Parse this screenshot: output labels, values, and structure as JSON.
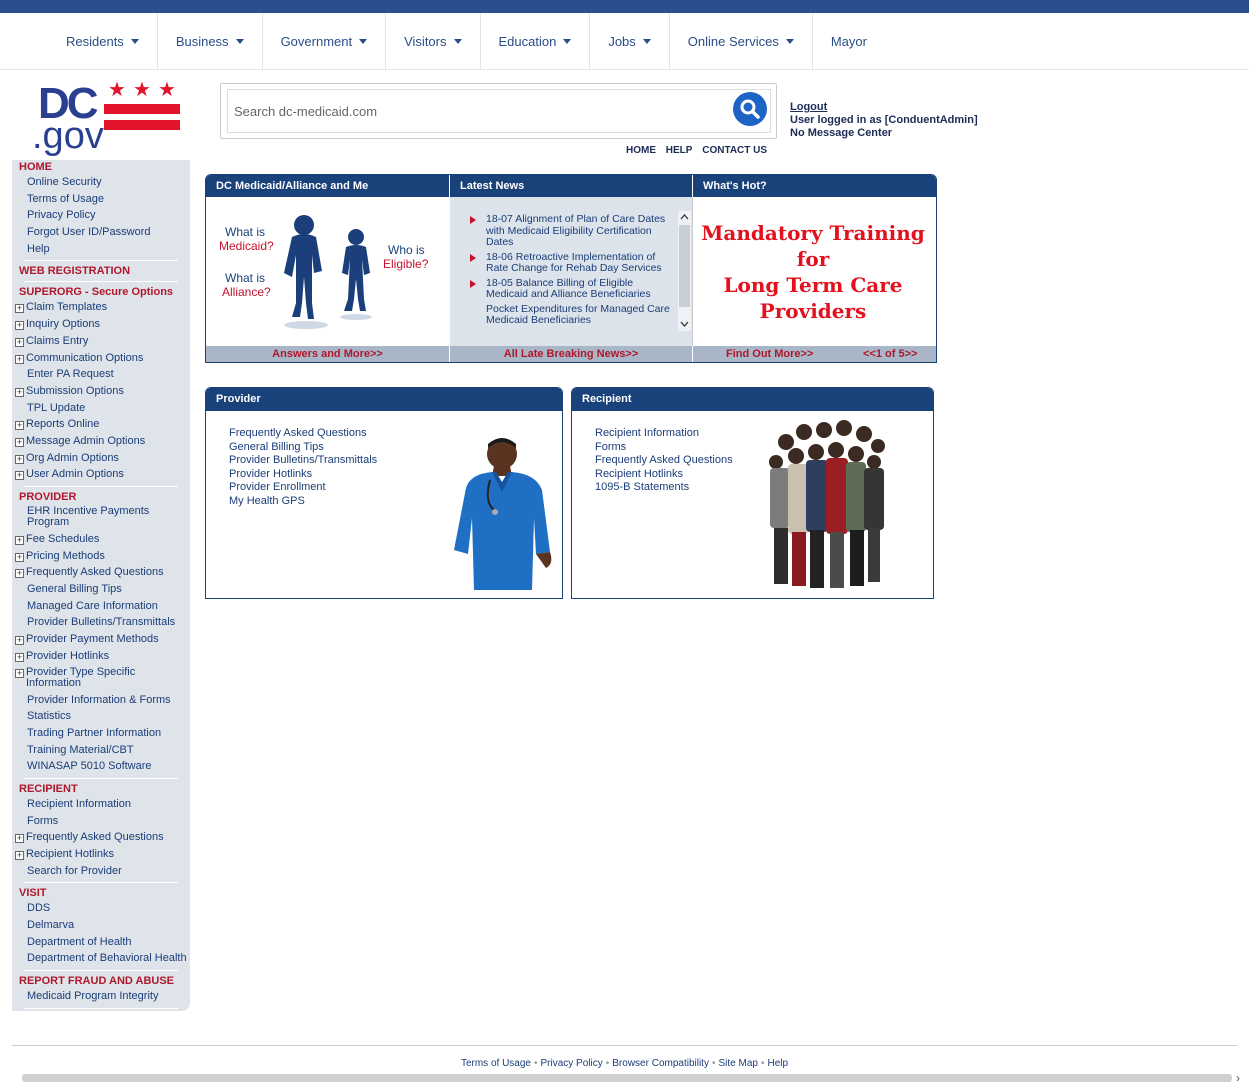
{
  "top_strip": {
    "title": ""
  },
  "main_nav": {
    "items": [
      "Residents",
      "Business",
      "Government",
      "Visitors",
      "Education",
      "Jobs",
      "Online Services",
      "Mayor"
    ],
    "has_caret": [
      true,
      true,
      true,
      true,
      true,
      true,
      true,
      false
    ]
  },
  "logo": {
    "dc": "DC",
    "gov": ".gov",
    "stars": "★ ★ ★"
  },
  "search": {
    "placeholder": "Search dc-medicaid.com"
  },
  "top_links": [
    "HOME",
    "HELP",
    "CONTACT US"
  ],
  "user": {
    "logout": "Logout",
    "logged_in": "User logged in as [ConduentAdmin]",
    "message": "No Message Center"
  },
  "left_nav": {
    "home_title": "HOME",
    "home_items": [
      "Online Security",
      "Terms of Usage",
      "Privacy Policy",
      "Forgot User ID/Password",
      "Help"
    ],
    "web_registration": "WEB REGISTRATION",
    "superorg_title": "SUPERORG - Secure Options",
    "superorg_items": [
      {
        "label": "Claim Templates",
        "expandable": true
      },
      {
        "label": "Inquiry Options",
        "expandable": true
      },
      {
        "label": "Claims Entry",
        "expandable": true
      },
      {
        "label": "Communication Options",
        "expandable": true
      },
      {
        "label": "Enter PA Request",
        "expandable": false
      },
      {
        "label": "Submission Options",
        "expandable": true
      },
      {
        "label": "TPL Update",
        "expandable": false
      },
      {
        "label": "Reports Online",
        "expandable": true
      },
      {
        "label": "Message Admin Options",
        "expandable": true
      },
      {
        "label": "Org Admin Options",
        "expandable": true
      },
      {
        "label": "User Admin Options",
        "expandable": true
      }
    ],
    "provider_title": "PROVIDER",
    "provider_items": [
      {
        "label": "EHR Incentive Payments Program",
        "expandable": false,
        "two_line": true
      },
      {
        "label": "Fee Schedules",
        "expandable": true
      },
      {
        "label": "Pricing Methods",
        "expandable": true
      },
      {
        "label": "Frequently Asked Questions",
        "expandable": true
      },
      {
        "label": "General Billing Tips",
        "expandable": false
      },
      {
        "label": "Managed Care Information",
        "expandable": false
      },
      {
        "label": "Provider Bulletins/Transmittals",
        "expandable": false
      },
      {
        "label": "Provider Payment Methods",
        "expandable": true
      },
      {
        "label": "Provider Hotlinks",
        "expandable": true
      },
      {
        "label": "Provider Type Specific Information",
        "expandable": true,
        "two_line": true
      },
      {
        "label": "Provider Information & Forms",
        "expandable": false
      },
      {
        "label": "Statistics",
        "expandable": false
      },
      {
        "label": "Trading Partner Information",
        "expandable": false
      },
      {
        "label": "Training Material/CBT",
        "expandable": false
      },
      {
        "label": "WINASAP 5010 Software",
        "expandable": false
      }
    ],
    "recipient_title": "RECIPIENT",
    "recipient_items": [
      {
        "label": "Recipient Information",
        "expandable": false
      },
      {
        "label": "Forms",
        "expandable": false
      },
      {
        "label": "Frequently Asked Questions",
        "expandable": true
      },
      {
        "label": "Recipient Hotlinks",
        "expandable": true
      },
      {
        "label": "Search for Provider",
        "expandable": false
      }
    ],
    "visit_title": "VISIT",
    "visit_items": [
      "DDS",
      "Delmarva",
      "Department of Health",
      "Department of Behavioral Health"
    ],
    "fraud_title": "REPORT FRAUD AND ABUSE",
    "fraud_items": [
      "Medicaid Program Integrity"
    ]
  },
  "panels": {
    "medicaid": {
      "header": "DC Medicaid/Alliance and Me",
      "what_is": "What is",
      "medicaid": "Medicaid?",
      "what_is2": "What is",
      "alliance": "Alliance?",
      "who_is": "Who is",
      "eligible": "Eligible?",
      "footer": "Answers and More>>"
    },
    "news": {
      "header": "Latest News",
      "items": [
        {
          "text": "18-07 Alignment of Plan of Care Dates with Medicaid Eligibility Certification Dates",
          "bullet": true
        },
        {
          "text": "18-06 Retroactive Implementation of Rate Change for Rehab Day Services",
          "bullet": true
        },
        {
          "text": "18-05 Balance Billing of Eligible Medicaid and Alliance Beneficiaries",
          "bullet": true
        },
        {
          "text": "Pocket Expenditures for Managed Care Medicaid Beneficiaries",
          "bullet": false
        }
      ],
      "footer": "All Late Breaking News>>"
    },
    "hot": {
      "header": "What's Hot?",
      "line1": "Mandatory Training",
      "line2": "for",
      "line3": "Long Term Care",
      "line4": "Providers",
      "footer": "Find Out More>>",
      "pager": "<<1 of 5>>"
    }
  },
  "provider_panel": {
    "header": "Provider",
    "links": [
      "Frequently Asked Questions",
      "General Billing Tips",
      "Provider Bulletins/Transmittals",
      "Provider Hotlinks",
      "Provider Enrollment",
      "My Health GPS"
    ]
  },
  "recipient_panel": {
    "header": "Recipient",
    "links": [
      "Recipient Information",
      "Forms",
      "Frequently Asked Questions",
      "Recipient Hotlinks",
      "1095-B Statements"
    ]
  },
  "footer": {
    "links": [
      "Terms of Usage",
      "Privacy Policy",
      "Browser Compatibility",
      "Site Map",
      "Help"
    ]
  },
  "colors": {
    "navy": "#1a427a",
    "red": "#c8102e",
    "nav_bg": "#dfe4ea"
  }
}
